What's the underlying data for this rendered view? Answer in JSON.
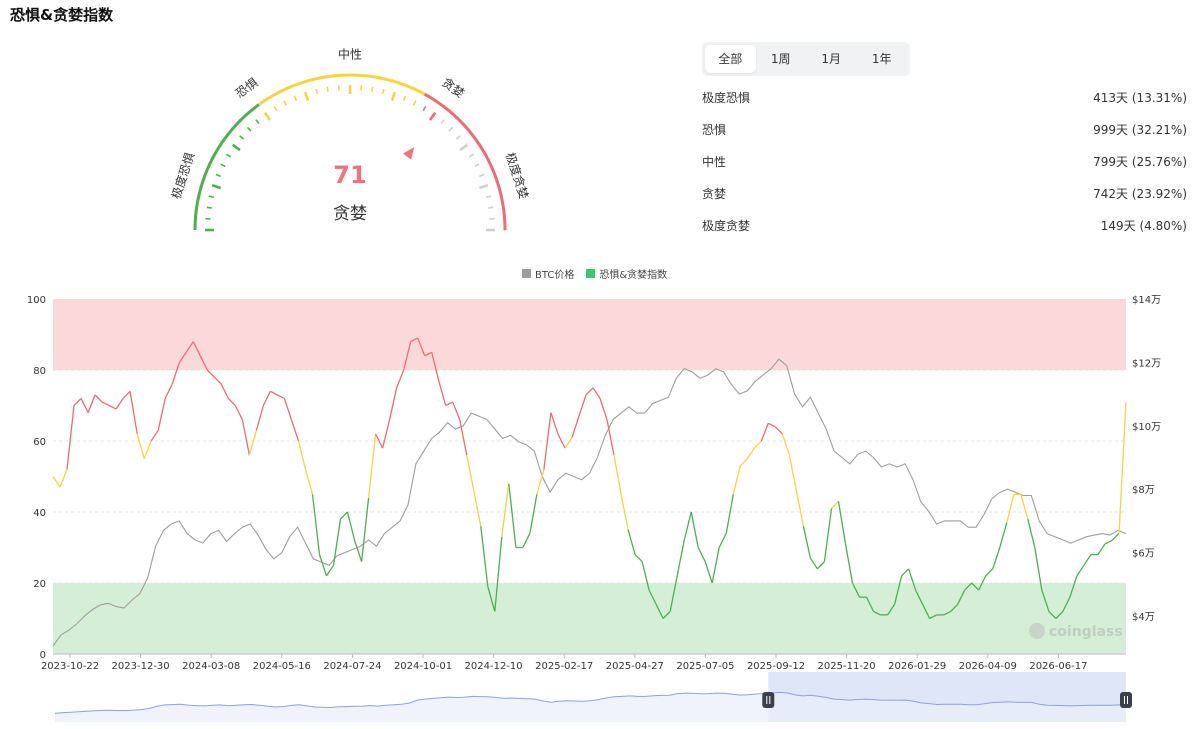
{
  "title": "恐惧&贪婪指数",
  "gauge": {
    "value": "71",
    "state": "贪婪",
    "labels": [
      "极度恐惧",
      "恐惧",
      "中性",
      "贪婪",
      "极度贪婪"
    ],
    "colors": {
      "fear_green": "#4cb050",
      "neutral_yellow": "#f5d442",
      "greed_red": "#ef6b73",
      "value_red": "#f0747b"
    }
  },
  "tabs": [
    "全部",
    "1周",
    "1月",
    "1年"
  ],
  "active_tab": "全部",
  "stats": [
    {
      "label": "极度恐惧",
      "value": "413天 (13.31%)"
    },
    {
      "label": "恐惧",
      "value": "999天 (32.21%)"
    },
    {
      "label": "中性",
      "value": "799天 (25.76%)"
    },
    {
      "label": "贪婪",
      "value": "742天 (23.92%)"
    },
    {
      "label": "极度贪婪",
      "value": "149天 (4.80%)"
    }
  ],
  "legend": [
    "BTC价格",
    "恐惧&贪婪指数"
  ],
  "watermark": "coinglass",
  "chart_data": {
    "type": "line",
    "x_tick_labels": [
      "2023-10-22",
      "2023-12-30",
      "2024-03-08",
      "2024-05-16",
      "2024-07-24",
      "2024-10-01",
      "2024-12-10",
      "2025-02-17",
      "2025-04-27",
      "2025-07-05",
      "2025-09-12",
      "2025-11-20",
      "2026-01-29",
      "2026-04-09",
      "2026-06-17"
    ],
    "y_left_ticks": [
      0,
      20,
      40,
      60,
      80,
      100
    ],
    "y_right_ticks": [
      "$4万",
      "$6万",
      "$8万",
      "$10万",
      "$12万",
      "$14万"
    ],
    "y_right_values": [
      40000,
      60000,
      80000,
      100000,
      120000,
      140000
    ],
    "ylim_left": [
      0,
      100
    ],
    "ylim_right": [
      28000,
      140000
    ],
    "zones": [
      {
        "from": 80,
        "to": 100,
        "color": "#fbd8da"
      },
      {
        "from": 0,
        "to": 20,
        "color": "#d5eed6"
      }
    ],
    "series": [
      {
        "name": "恐惧&贪婪指数",
        "color": "#4bbd74",
        "values": [
          50,
          47,
          52,
          70,
          72,
          68,
          73,
          71,
          70,
          69,
          72,
          74,
          62,
          55,
          60,
          63,
          72,
          76,
          82,
          85,
          88,
          84,
          80,
          78,
          76,
          72,
          70,
          66,
          56,
          63,
          70,
          74,
          73,
          72,
          66,
          60,
          52,
          45,
          28,
          22,
          25,
          38,
          40,
          32,
          26,
          44,
          62,
          58,
          66,
          75,
          80,
          88,
          89,
          84,
          85,
          77,
          70,
          71,
          66,
          56,
          46,
          36,
          19,
          12,
          33,
          48,
          30,
          30,
          34,
          45,
          52,
          68,
          62,
          58,
          61,
          67,
          73,
          75,
          72,
          66,
          56,
          45,
          35,
          28,
          26,
          18,
          14,
          10,
          12,
          22,
          32,
          40,
          30,
          26,
          20,
          30,
          34,
          45,
          53,
          55,
          58,
          60,
          65,
          64,
          62,
          56,
          46,
          36,
          27,
          24,
          26,
          41,
          43,
          31,
          20,
          16,
          16,
          12,
          11,
          11,
          14,
          22,
          24,
          18,
          14,
          10,
          11,
          11,
          12,
          14,
          18,
          20,
          18,
          22,
          24,
          30,
          37,
          45,
          45,
          38,
          30,
          18,
          12,
          10,
          12,
          16,
          22,
          25,
          28,
          28,
          31,
          32,
          34,
          71
        ]
      },
      {
        "name": "BTC价格",
        "color": "#9e9e9e",
        "values": [
          30500,
          34000,
          35500,
          37500,
          40000,
          42000,
          43500,
          44000,
          43000,
          42500,
          45000,
          47000,
          52000,
          62000,
          67000,
          69000,
          70000,
          66000,
          64000,
          63000,
          66000,
          67000,
          63500,
          66000,
          68000,
          69000,
          65500,
          61000,
          58000,
          60000,
          65000,
          68000,
          63000,
          58000,
          57000,
          56000,
          59000,
          60000,
          61000,
          62000,
          64000,
          62000,
          66000,
          68000,
          70000,
          75000,
          88000,
          92000,
          96000,
          98000,
          101000,
          99000,
          100000,
          104000,
          103000,
          102000,
          99000,
          96000,
          97000,
          95000,
          94000,
          92000,
          84000,
          79000,
          83000,
          85000,
          84000,
          83000,
          85000,
          90000,
          97000,
          102000,
          104000,
          106000,
          104000,
          104000,
          107000,
          108000,
          109000,
          115000,
          118000,
          117000,
          115000,
          116000,
          118000,
          117000,
          113000,
          110000,
          111000,
          114000,
          116000,
          118000,
          121000,
          119000,
          110000,
          106000,
          109000,
          104000,
          99000,
          92000,
          90000,
          88000,
          91000,
          92000,
          90000,
          87000,
          88000,
          87000,
          88000,
          83000,
          76000,
          73000,
          69000,
          70000,
          70000,
          70000,
          68000,
          68000,
          72000,
          77000,
          79000,
          80000,
          79000,
          78000,
          78000,
          70000,
          66000,
          65000,
          64000,
          63000,
          64000,
          65000,
          65500,
          66000,
          65500,
          67000,
          66000
        ]
      }
    ]
  }
}
